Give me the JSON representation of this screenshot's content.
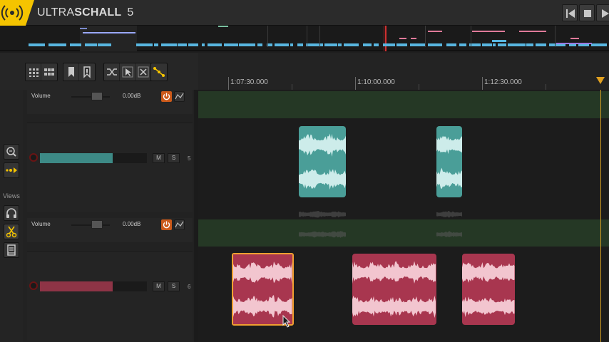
{
  "app": {
    "name_light": "ULTRA",
    "name_bold": "SCHALL",
    "version": "5",
    "accent_color": "#f5c400"
  },
  "transport": {
    "buttons": [
      "skip-to-start-icon",
      "stop-icon",
      "play-icon"
    ]
  },
  "toolbar": {
    "groups": [
      [
        "grid-view-icon",
        "grid-dense-icon"
      ],
      [
        "bookmark-icon",
        "bookmark-add-icon"
      ],
      [
        "ripple-icon",
        "cursor-select-icon",
        "crossfade-icon"
      ],
      [
        "snap-icon"
      ]
    ]
  },
  "sidebar": {
    "views_label": "Views",
    "icons": [
      "zoom-icon",
      "follow-playhead-icon",
      "headphones-icon",
      "scissors-icon",
      "notes-icon"
    ],
    "active": "scissors-icon"
  },
  "ruler": {
    "labels": [
      "1:07:30.000",
      "1:10:00.000",
      "1:12:30.000"
    ]
  },
  "tracks": [
    {
      "envelope": {
        "label": "Volume",
        "value": "0.00dB"
      },
      "mute": "M",
      "solo": "S",
      "number": "5",
      "meter_level": 0.68,
      "color": "#3d8a86"
    },
    {
      "envelope": {
        "label": "Volume",
        "value": "0.00dB"
      },
      "mute": "M",
      "solo": "S",
      "number": "6",
      "meter_level": 0.68,
      "color": "#8e3446"
    }
  ],
  "colors": {
    "teal_clip": "#4a9e98",
    "teal_wave": "#cdecea",
    "red_clip": "#a8364f",
    "red_wave": "#f2c5cf",
    "selection": "#f0a030",
    "envelope_lane": "#253825",
    "power_button": "#cc5a1a"
  }
}
